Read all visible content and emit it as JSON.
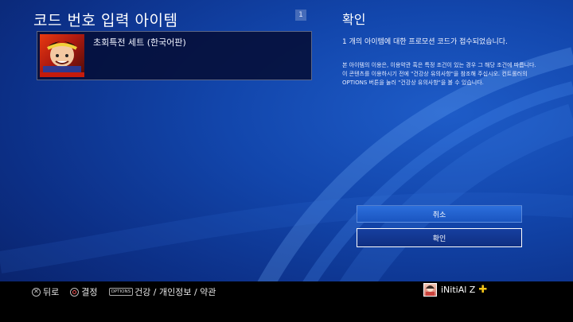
{
  "header": {
    "title": "코드 번호 입력 아이템",
    "item_count": "1"
  },
  "item": {
    "name": "초회특전 세트 (한국어판)"
  },
  "confirm": {
    "title": "확인",
    "message": "1 개의 아이템에 대한 프로모션 코드가 접수되었습니다.",
    "notice_1": "본 아이템의 이용은, 이용약관 혹은 특정 조건이 있는 경우 그 해당 조건에 따릅니다.",
    "notice_2": "이 콘텐츠를 이용하시기 전에 \"건강상 유의사항\"을 참조해 주십시오. 컨트롤러의 OPTIONS 버튼을 눌러 \"건강상 유의사항\"을 볼 수 있습니다."
  },
  "buttons": {
    "cancel": "취소",
    "ok": "확인"
  },
  "footer": {
    "back_symbol": "✕",
    "back": "뒤로",
    "decide": "결정",
    "options_badge": "OPTIONS",
    "options_label": "건강 / 개인정보 / 약관",
    "username": "iNitiAl Z",
    "plus_symbol": "✚"
  },
  "colors": {
    "accent": "#1a55c0",
    "plus": "#f2c418",
    "bar": "#000000"
  }
}
